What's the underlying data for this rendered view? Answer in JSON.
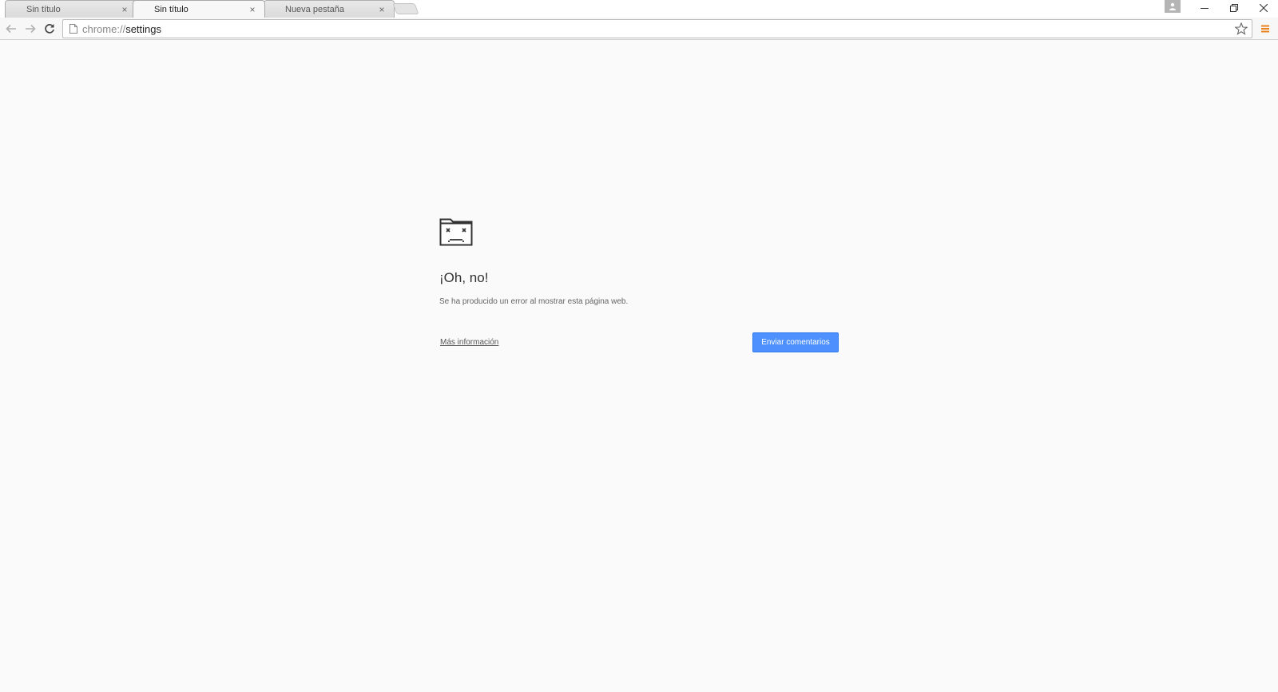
{
  "tabs": [
    {
      "title": "Sin título",
      "active": false
    },
    {
      "title": "Sin título",
      "active": true
    },
    {
      "title": "Nueva pestaña",
      "active": false
    }
  ],
  "tab_close_glyph": "×",
  "window_controls": {
    "minimize_icon": "minimize-icon",
    "restore_icon": "restore-icon",
    "close_icon": "close-icon"
  },
  "omnibox": {
    "scheme": "chrome://",
    "path": "settings"
  },
  "error": {
    "title": "¡Oh, no!",
    "description": "Se ha producido un error al mostrar esta página web.",
    "more_info_link": "Más información",
    "feedback_button": "Enviar comentarios"
  },
  "colors": {
    "button_blue": "#4d90fe",
    "menu_orange": "#e8821c",
    "page_background": "#fafafa"
  }
}
